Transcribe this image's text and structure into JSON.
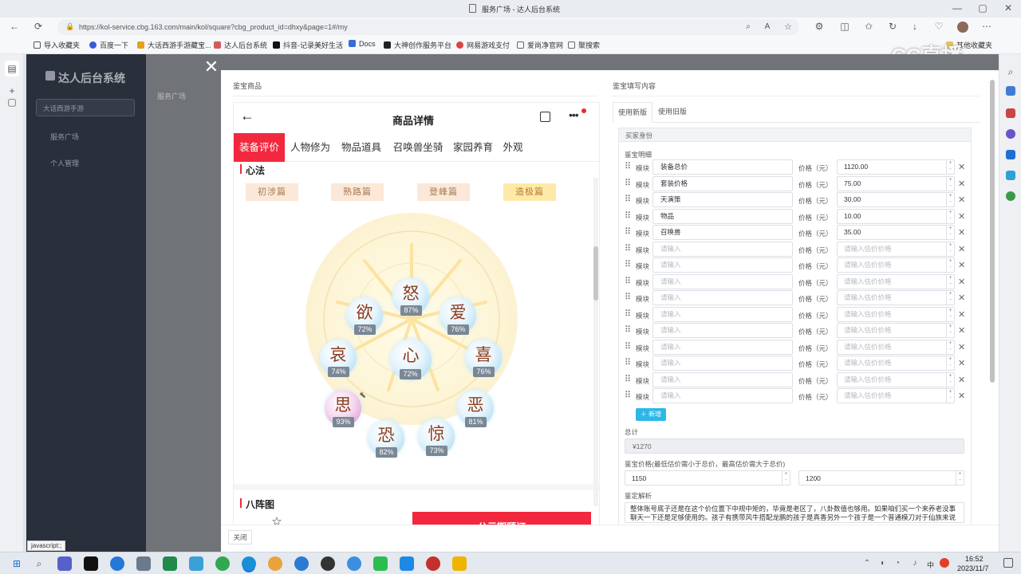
{
  "browser": {
    "tab_title": "服务广场 - 达人后台系统",
    "url": "https://kol-service.cbg.163.com/main/kol/square?cbg_product_id=dhxy&page=1#/my",
    "bookmarks": [
      "导入收藏夹",
      "百度一下",
      "大话西游手游藏宝...",
      "达人后台系统",
      "抖音-记录美好生活",
      "Docs",
      "大神创作服务平台",
      "网易游戏支付",
      "爱尚净官网",
      "聚搜索",
      "其他收藏夹"
    ],
    "status_text": "javascript:;",
    "watermark": "CC直播"
  },
  "admin": {
    "title": "达人后台系统",
    "game_select": "大话西游手游",
    "menu": [
      "服务广场",
      "个人管理"
    ],
    "breadcrumb": "服务广场"
  },
  "modal": {
    "left_title": "鉴宝商品",
    "right_title": "鉴宝填写内容",
    "close_button": "关闭"
  },
  "product": {
    "header": "商品详情",
    "tabs": [
      "装备评价",
      "人物修为",
      "物品道具",
      "召唤兽坐骑",
      "家园养育",
      "外观"
    ],
    "section1": "心法",
    "stages": [
      "初涉篇",
      "熟路篇",
      "登峰篇",
      "造极篇"
    ],
    "orbs": [
      {
        "char": "怒",
        "pct": "87%"
      },
      {
        "char": "欲",
        "pct": "72%"
      },
      {
        "char": "爱",
        "pct": "76%"
      },
      {
        "char": "哀",
        "pct": "74%"
      },
      {
        "char": "心",
        "pct": "72%"
      },
      {
        "char": "喜",
        "pct": "76%"
      },
      {
        "char": "思",
        "pct": "93%"
      },
      {
        "char": "恶",
        "pct": "81%"
      },
      {
        "char": "恐",
        "pct": "82%"
      },
      {
        "char": "惊",
        "pct": "73%"
      }
    ],
    "section2": "八阵图",
    "favorite": "收藏",
    "reserve_button": "公示期预订"
  },
  "form": {
    "tabs": [
      "使用新版",
      "使用旧版"
    ],
    "buyer_identity": "买家身份",
    "detail_label": "鉴宝明细",
    "module_label": "模块",
    "price_label": "价格（元）",
    "rows": [
      {
        "name": "装备总价",
        "price": "1120.00"
      },
      {
        "name": "套装价格",
        "price": "75.00"
      },
      {
        "name": "天演策",
        "price": "30.00"
      },
      {
        "name": "物品",
        "price": "10.00"
      },
      {
        "name": "召唤兽",
        "price": "35.00"
      },
      {
        "name": "",
        "price": ""
      },
      {
        "name": "",
        "price": ""
      },
      {
        "name": "",
        "price": ""
      },
      {
        "name": "",
        "price": ""
      },
      {
        "name": "",
        "price": ""
      },
      {
        "name": "",
        "price": ""
      },
      {
        "name": "",
        "price": ""
      },
      {
        "name": "",
        "price": ""
      },
      {
        "name": "",
        "price": ""
      },
      {
        "name": "",
        "price": ""
      }
    ],
    "name_placeholder": "请输入",
    "price_placeholder": "请输入估价价格",
    "add_button": "新增",
    "total_label": "总计",
    "total_value": "¥1270",
    "range_label": "鉴宝价格(最低估价需小于总价，最高估价需大于总价)",
    "min_price": "1150",
    "max_price": "1200",
    "analysis_label": "鉴定解析",
    "analysis_text": "整体账号底子还是在这个价位置下中规中矩的，毕竟是老区了，八卦数值也够用。如果咱们买一个来养老没事聊天一下还是足够使用的。孩子有携带风牛搭配龙鹏的孩子是真香另外一个孩子是一个普通模刀对于仙族来说没啥"
  },
  "taskbar": {
    "time": "16:52",
    "date": "2023/11/7",
    "lang": "中"
  }
}
